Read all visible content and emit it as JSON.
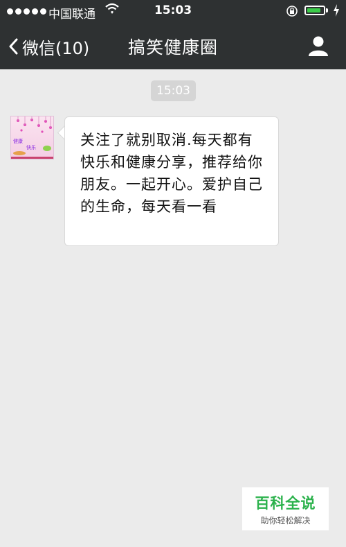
{
  "status_bar": {
    "carrier": "中国联通",
    "time": "15:03",
    "battery_level": 0.85
  },
  "nav": {
    "back_label": "微信(10)",
    "title": "搞笑健康圈"
  },
  "chat": {
    "timestamp": "15:03",
    "message": "关注了就别取消.每天都有快乐和健康分享，推荐给你朋友。一起开心。爱护自己的生命，每天看一看",
    "avatar_text": [
      "健康",
      "快乐"
    ]
  },
  "watermark": {
    "title": "百科全说",
    "subtitle": "助你轻松解决"
  },
  "colors": {
    "nav_bg": "#2e3132",
    "chat_bg": "#ebebeb",
    "battery": "#3ccd4a",
    "brand_green": "#2bb24c"
  }
}
